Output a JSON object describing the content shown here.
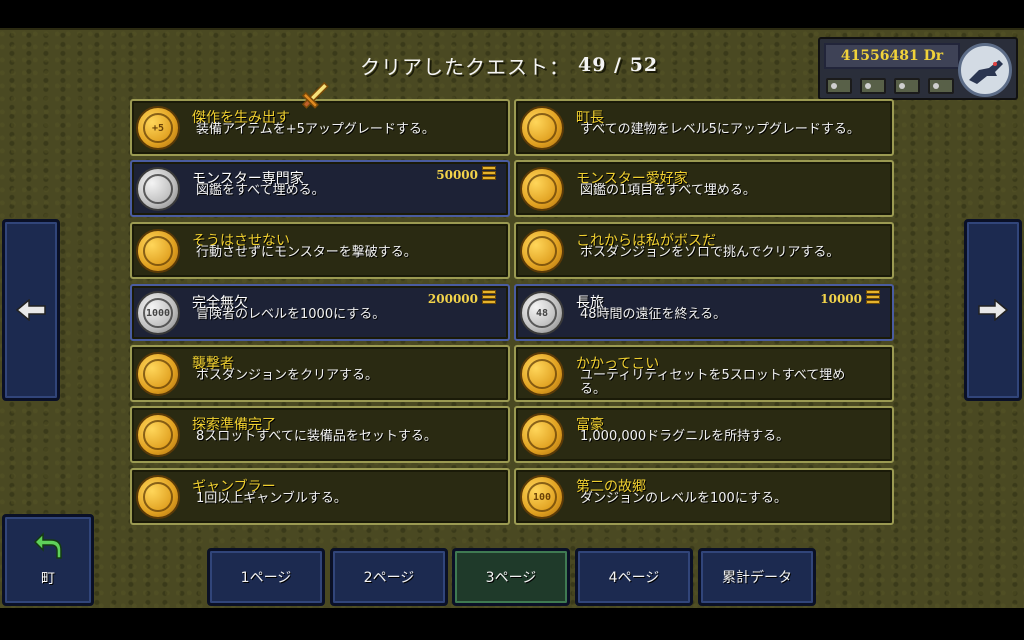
{
  "header": {
    "title": "クリアしたクエスト：",
    "progress": "49 / 52"
  },
  "money": {
    "amount": "41556481 Dr"
  },
  "nav": {
    "left_icon": "arrow-left-icon",
    "right_icon": "arrow-right-icon"
  },
  "quests": [
    {
      "title": "傑作を生み出す",
      "desc": "装備アイテムを+5アップグレードする。",
      "coin": "gold",
      "coin_text": "+5",
      "reward": ""
    },
    {
      "title": "町長",
      "desc": "すべての建物をレベル5にアップグレードする。",
      "coin": "gold",
      "coin_text": "",
      "reward": ""
    },
    {
      "title": "モンスター専門家",
      "desc": "図鑑をすべて埋める。",
      "coin": "silver",
      "coin_text": "",
      "reward": "50000"
    },
    {
      "title": "モンスター愛好家",
      "desc": "図鑑の1項目をすべて埋める。",
      "coin": "gold",
      "coin_text": "",
      "reward": ""
    },
    {
      "title": "そうはさせない",
      "desc": "行動させずにモンスターを撃破する。",
      "coin": "gold",
      "coin_text": "",
      "reward": ""
    },
    {
      "title": "これからは私がボスだ",
      "desc": "ボスダンジョンをソロで挑んでクリアする。",
      "coin": "gold",
      "coin_text": "",
      "reward": ""
    },
    {
      "title": "完全無欠",
      "desc": "冒険者のレベルを1000にする。",
      "coin": "silver",
      "coin_text": "1000",
      "reward": "200000"
    },
    {
      "title": "長旅",
      "desc": "48時間の遠征を終える。",
      "coin": "silver",
      "coin_text": "48",
      "reward": "10000"
    },
    {
      "title": "襲撃者",
      "desc": "ボスダンジョンをクリアする。",
      "coin": "gold",
      "coin_text": "",
      "reward": ""
    },
    {
      "title": "かかってこい",
      "desc": "ユーティリティセットを5スロットすべて埋める。",
      "coin": "gold",
      "coin_text": "",
      "reward": ""
    },
    {
      "title": "探索準備完了",
      "desc": "8スロットすべてに装備品をセットする。",
      "coin": "gold",
      "coin_text": "",
      "reward": ""
    },
    {
      "title": "富豪",
      "desc": "1,000,000ドラグニルを所持する。",
      "coin": "gold",
      "coin_text": "",
      "reward": ""
    },
    {
      "title": "ギャンブラー",
      "desc": "1回以上ギャンブルする。",
      "coin": "gold",
      "coin_text": "",
      "reward": ""
    },
    {
      "title": "第二の故郷",
      "desc": "ダンジョンのレベルを100にする。",
      "coin": "gold",
      "coin_text": "100",
      "reward": ""
    }
  ],
  "home": {
    "label": "町"
  },
  "tabs": [
    {
      "label": "1ページ"
    },
    {
      "label": "2ページ"
    },
    {
      "label": "3ページ"
    },
    {
      "label": "4ページ"
    },
    {
      "label": "累計データ"
    }
  ],
  "active_tab": 2
}
